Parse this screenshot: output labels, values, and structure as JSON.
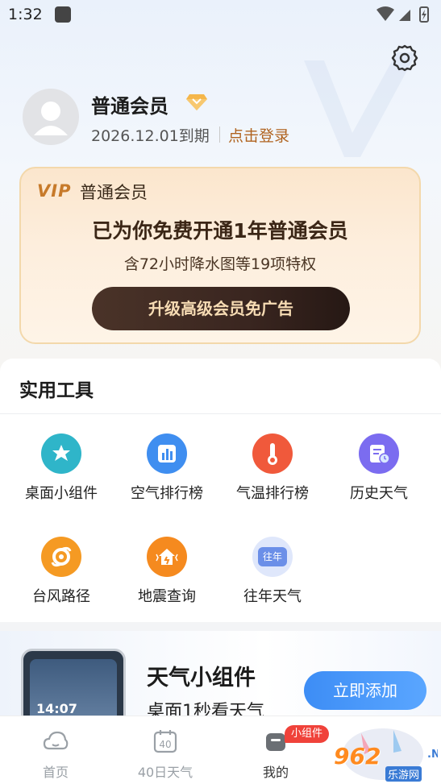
{
  "status_bar": {
    "time": "1:32"
  },
  "profile": {
    "member_name": "普通会员",
    "expire_text": "2026.12.01到期",
    "login_link": "点击登录"
  },
  "vip_card": {
    "logo": "VIP",
    "label": "普通会员",
    "headline": "已为你免费开通1年普通会员",
    "subline": "含72小时降水图等19项特权",
    "upgrade_button": "升级高级会员免广告"
  },
  "tools": {
    "title": "实用工具",
    "items": [
      {
        "label": "桌面小组件",
        "icon": "widget-icon",
        "color": "#2fb5c9"
      },
      {
        "label": "空气排行榜",
        "icon": "bar-chart-icon",
        "color": "#3f8ef0"
      },
      {
        "label": "气温排行榜",
        "icon": "thermometer-icon",
        "color": "#f0593b"
      },
      {
        "label": "历史天气",
        "icon": "history-calendar-icon",
        "color": "#7b6cf0"
      },
      {
        "label": "台风路径",
        "icon": "typhoon-icon",
        "color": "#f59a23"
      },
      {
        "label": "地震查询",
        "icon": "earthquake-house-icon",
        "color": "#f58a1f"
      },
      {
        "label": "往年天气",
        "icon": "past-years-icon",
        "color": "#6b8fe8",
        "badge_text": "往年"
      }
    ]
  },
  "promo": {
    "phone_time": "14:07",
    "title": "天气小组件",
    "subtitle": "桌面1秒看天气",
    "add_button": "立即添加"
  },
  "bottom_nav": {
    "items": [
      {
        "label": "首页",
        "icon": "home-cloud-icon"
      },
      {
        "label": "40日天气",
        "icon": "calendar-40-icon",
        "calendar_number": "40"
      },
      {
        "label": "我的",
        "icon": "profile-icon",
        "active": true
      }
    ],
    "badge": "小组件"
  },
  "watermark": {
    "text": "962",
    "sub": "乐游网",
    "net": ".NET"
  }
}
